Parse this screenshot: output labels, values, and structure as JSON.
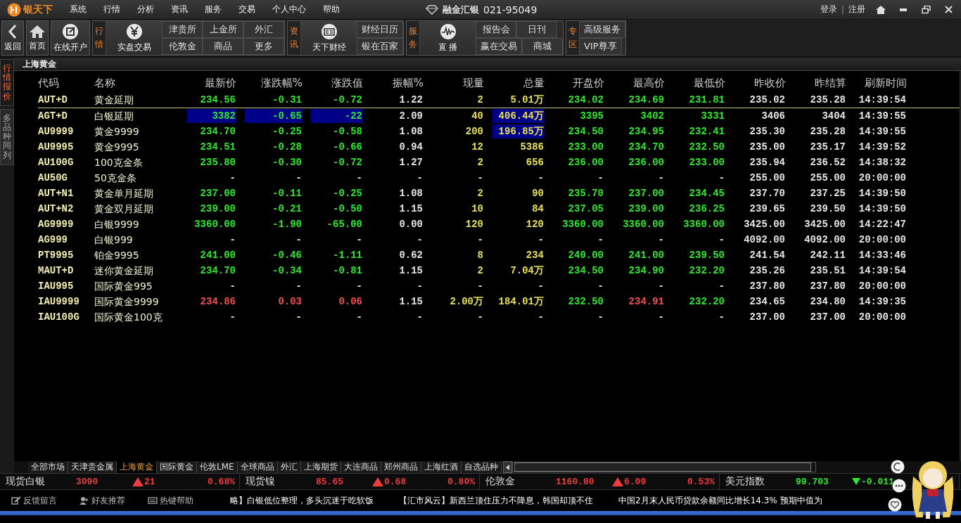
{
  "menu_bar": {
    "logo": "银天下",
    "items": [
      "系统",
      "行情",
      "分析",
      "资讯",
      "服务",
      "交易",
      "个人中心",
      "帮助"
    ],
    "brand": "融金汇银",
    "hotline": "021-95049",
    "login": "登录",
    "separator": "|",
    "register": "注册"
  },
  "toolbar": {
    "nav": [
      {
        "label": "返回"
      },
      {
        "label": "首页"
      },
      {
        "label": "在线开户"
      }
    ],
    "groups": [
      {
        "label": "行情",
        "feature": "实盘交易",
        "link_rows": [
          [
            "津贵所",
            "上金所",
            "外汇"
          ],
          [
            "伦敦金",
            "商品",
            "更多"
          ]
        ]
      },
      {
        "label": "资讯",
        "feature": "天下财经",
        "link_rows": [
          [
            "财经日历"
          ],
          [
            "银在百家"
          ]
        ]
      },
      {
        "label": "服务",
        "feature": "直 播",
        "link_rows": [
          [
            "报告会",
            "日刊"
          ],
          [
            "赢在交易",
            "商城"
          ]
        ]
      },
      {
        "label": "专区",
        "link_rows": [
          [
            "高级服务"
          ],
          [
            "VIP尊享"
          ]
        ]
      }
    ]
  },
  "side_tabs": [
    {
      "label": "行情报价",
      "selected": true
    },
    {
      "label": "多品种同列",
      "selected": false
    }
  ],
  "panel_title": "上海黄金",
  "table": {
    "columns": [
      "代码",
      "名称",
      "最新价",
      "涨跌幅%",
      "涨跌值",
      "振幅%",
      "现量",
      "总量",
      "开盘价",
      "最高价",
      "最低价",
      "昨收价",
      "昨结算",
      "刷新时间"
    ],
    "rows": [
      {
        "cells": [
          {
            "text": "AUT+D",
            "color": "#f2eeb0",
            "highlighted": false
          },
          {
            "text": "黄金延期",
            "color": "#f0f0d0",
            "highlighted": false
          },
          {
            "text": "234.56",
            "color": "#2ee82e",
            "highlighted": false
          },
          {
            "text": "-0.31",
            "color": "#2ee82e",
            "highlighted": false
          },
          {
            "text": "-0.72",
            "color": "#2ee82e",
            "highlighted": false
          },
          {
            "text": "1.22",
            "color": "#e6e6e6",
            "highlighted": false
          },
          {
            "text": "2",
            "color": "#e6e05a",
            "highlighted": false
          },
          {
            "text": "5.01万",
            "color": "#e6e05a",
            "highlighted": false
          },
          {
            "text": "234.02",
            "color": "#2ee82e",
            "highlighted": false
          },
          {
            "text": "234.69",
            "color": "#2ee82e",
            "highlighted": false
          },
          {
            "text": "231.81",
            "color": "#2ee82e",
            "highlighted": false
          },
          {
            "text": "235.02",
            "color": "#e6e6e6",
            "highlighted": false
          },
          {
            "text": "235.28",
            "color": "#e6e6e6",
            "highlighted": false
          },
          {
            "text": "14:39:54",
            "color": "#e6e6e6",
            "highlighted": false
          }
        ]
      },
      {
        "cells": [
          {
            "text": "AGT+D",
            "color": "#f2eeb0",
            "highlighted": false
          },
          {
            "text": "白银延期",
            "color": "#f0f0d0",
            "highlighted": false
          },
          {
            "text": "3382",
            "color": "#2ee82e",
            "highlighted": true
          },
          {
            "text": "-0.65",
            "color": "#2ee82e",
            "highlighted": true
          },
          {
            "text": "-22",
            "color": "#2ee82e",
            "highlighted": true
          },
          {
            "text": "2.09",
            "color": "#e6e6e6",
            "highlighted": false
          },
          {
            "text": "40",
            "color": "#e6e05a",
            "highlighted": false
          },
          {
            "text": "406.44万",
            "color": "#e6e05a",
            "highlighted": true
          },
          {
            "text": "3395",
            "color": "#2ee82e",
            "highlighted": false
          },
          {
            "text": "3402",
            "color": "#2ee82e",
            "highlighted": false
          },
          {
            "text": "3331",
            "color": "#2ee82e",
            "highlighted": false
          },
          {
            "text": "3406",
            "color": "#e6e6e6",
            "highlighted": false
          },
          {
            "text": "3404",
            "color": "#e6e6e6",
            "highlighted": false
          },
          {
            "text": "14:39:55",
            "color": "#e6e6e6",
            "highlighted": false
          }
        ]
      },
      {
        "cells": [
          {
            "text": "AU9999",
            "color": "#f2eeb0",
            "highlighted": false
          },
          {
            "text": "黄金9999",
            "color": "#f0f0d0",
            "highlighted": false
          },
          {
            "text": "234.70",
            "color": "#2ee82e",
            "highlighted": false
          },
          {
            "text": "-0.25",
            "color": "#2ee82e",
            "highlighted": false
          },
          {
            "text": "-0.58",
            "color": "#2ee82e",
            "highlighted": false
          },
          {
            "text": "1.08",
            "color": "#e6e6e6",
            "highlighted": false
          },
          {
            "text": "200",
            "color": "#e6e05a",
            "highlighted": false
          },
          {
            "text": "196.85万",
            "color": "#e6e05a",
            "highlighted": true
          },
          {
            "text": "234.50",
            "color": "#2ee82e",
            "highlighted": false
          },
          {
            "text": "234.95",
            "color": "#2ee82e",
            "highlighted": false
          },
          {
            "text": "232.41",
            "color": "#2ee82e",
            "highlighted": false
          },
          {
            "text": "235.30",
            "color": "#e6e6e6",
            "highlighted": false
          },
          {
            "text": "235.28",
            "color": "#e6e6e6",
            "highlighted": false
          },
          {
            "text": "14:39:55",
            "color": "#e6e6e6",
            "highlighted": false
          }
        ]
      },
      {
        "cells": [
          {
            "text": "AU9995",
            "color": "#f2eeb0",
            "highlighted": false
          },
          {
            "text": "黄金9995",
            "color": "#f0f0d0",
            "highlighted": false
          },
          {
            "text": "234.51",
            "color": "#2ee82e",
            "highlighted": false
          },
          {
            "text": "-0.28",
            "color": "#2ee82e",
            "highlighted": false
          },
          {
            "text": "-0.66",
            "color": "#2ee82e",
            "highlighted": false
          },
          {
            "text": "0.94",
            "color": "#e6e6e6",
            "highlighted": false
          },
          {
            "text": "12",
            "color": "#e6e05a",
            "highlighted": false
          },
          {
            "text": "5386",
            "color": "#e6e05a",
            "highlighted": false
          },
          {
            "text": "233.00",
            "color": "#2ee82e",
            "highlighted": false
          },
          {
            "text": "234.70",
            "color": "#2ee82e",
            "highlighted": false
          },
          {
            "text": "232.50",
            "color": "#2ee82e",
            "highlighted": false
          },
          {
            "text": "235.00",
            "color": "#e6e6e6",
            "highlighted": false
          },
          {
            "text": "235.17",
            "color": "#e6e6e6",
            "highlighted": false
          },
          {
            "text": "14:39:52",
            "color": "#e6e6e6",
            "highlighted": false
          }
        ]
      },
      {
        "cells": [
          {
            "text": "AU100G",
            "color": "#f2eeb0",
            "highlighted": false
          },
          {
            "text": "100克金条",
            "color": "#f0f0d0",
            "highlighted": false
          },
          {
            "text": "235.80",
            "color": "#2ee82e",
            "highlighted": false
          },
          {
            "text": "-0.30",
            "color": "#2ee82e",
            "highlighted": false
          },
          {
            "text": "-0.72",
            "color": "#2ee82e",
            "highlighted": false
          },
          {
            "text": "1.27",
            "color": "#e6e6e6",
            "highlighted": false
          },
          {
            "text": "2",
            "color": "#e6e05a",
            "highlighted": false
          },
          {
            "text": "656",
            "color": "#e6e05a",
            "highlighted": false
          },
          {
            "text": "236.00",
            "color": "#2ee82e",
            "highlighted": false
          },
          {
            "text": "236.00",
            "color": "#2ee82e",
            "highlighted": false
          },
          {
            "text": "233.00",
            "color": "#2ee82e",
            "highlighted": false
          },
          {
            "text": "235.94",
            "color": "#e6e6e6",
            "highlighted": false
          },
          {
            "text": "236.52",
            "color": "#e6e6e6",
            "highlighted": false
          },
          {
            "text": "14:38:32",
            "color": "#e6e6e6",
            "highlighted": false
          }
        ]
      },
      {
        "cells": [
          {
            "text": "AU50G",
            "color": "#f2eeb0",
            "highlighted": false
          },
          {
            "text": "50克金条",
            "color": "#f0f0d0",
            "highlighted": false
          },
          {
            "text": "-",
            "color": "#e6e6e6",
            "highlighted": false
          },
          {
            "text": "-",
            "color": "#e6e6e6",
            "highlighted": false
          },
          {
            "text": "-",
            "color": "#e6e6e6",
            "highlighted": false
          },
          {
            "text": "-",
            "color": "#e6e6e6",
            "highlighted": false
          },
          {
            "text": "-",
            "color": "#e6e6e6",
            "highlighted": false
          },
          {
            "text": "-",
            "color": "#e6e6e6",
            "highlighted": false
          },
          {
            "text": "-",
            "color": "#e6e6e6",
            "highlighted": false
          },
          {
            "text": "-",
            "color": "#e6e6e6",
            "highlighted": false
          },
          {
            "text": "-",
            "color": "#e6e6e6",
            "highlighted": false
          },
          {
            "text": "255.00",
            "color": "#e6e6e6",
            "highlighted": false
          },
          {
            "text": "255.00",
            "color": "#e6e6e6",
            "highlighted": false
          },
          {
            "text": "20:00:00",
            "color": "#e6e6e6",
            "highlighted": false
          }
        ]
      },
      {
        "cells": [
          {
            "text": "AUT+N1",
            "color": "#f2eeb0",
            "highlighted": false
          },
          {
            "text": "黄金单月延期",
            "color": "#f0f0d0",
            "highlighted": false
          },
          {
            "text": "237.00",
            "color": "#2ee82e",
            "highlighted": false
          },
          {
            "text": "-0.11",
            "color": "#2ee82e",
            "highlighted": false
          },
          {
            "text": "-0.25",
            "color": "#2ee82e",
            "highlighted": false
          },
          {
            "text": "1.08",
            "color": "#e6e6e6",
            "highlighted": false
          },
          {
            "text": "2",
            "color": "#e6e05a",
            "highlighted": false
          },
          {
            "text": "90",
            "color": "#e6e05a",
            "highlighted": false
          },
          {
            "text": "235.70",
            "color": "#2ee82e",
            "highlighted": false
          },
          {
            "text": "237.00",
            "color": "#2ee82e",
            "highlighted": false
          },
          {
            "text": "234.45",
            "color": "#2ee82e",
            "highlighted": false
          },
          {
            "text": "237.70",
            "color": "#e6e6e6",
            "highlighted": false
          },
          {
            "text": "237.25",
            "color": "#e6e6e6",
            "highlighted": false
          },
          {
            "text": "14:39:50",
            "color": "#e6e6e6",
            "highlighted": false
          }
        ]
      },
      {
        "cells": [
          {
            "text": "AUT+N2",
            "color": "#f2eeb0",
            "highlighted": false
          },
          {
            "text": "黄金双月延期",
            "color": "#f0f0d0",
            "highlighted": false
          },
          {
            "text": "239.00",
            "color": "#2ee82e",
            "highlighted": false
          },
          {
            "text": "-0.21",
            "color": "#2ee82e",
            "highlighted": false
          },
          {
            "text": "-0.50",
            "color": "#2ee82e",
            "highlighted": false
          },
          {
            "text": "1.15",
            "color": "#e6e6e6",
            "highlighted": false
          },
          {
            "text": "10",
            "color": "#e6e05a",
            "highlighted": false
          },
          {
            "text": "84",
            "color": "#e6e05a",
            "highlighted": false
          },
          {
            "text": "237.05",
            "color": "#2ee82e",
            "highlighted": false
          },
          {
            "text": "239.00",
            "color": "#2ee82e",
            "highlighted": false
          },
          {
            "text": "236.25",
            "color": "#2ee82e",
            "highlighted": false
          },
          {
            "text": "239.65",
            "color": "#e6e6e6",
            "highlighted": false
          },
          {
            "text": "239.50",
            "color": "#e6e6e6",
            "highlighted": false
          },
          {
            "text": "14:39:50",
            "color": "#e6e6e6",
            "highlighted": false
          }
        ]
      },
      {
        "cells": [
          {
            "text": "AG9999",
            "color": "#f2eeb0",
            "highlighted": false
          },
          {
            "text": "白银9999",
            "color": "#f0f0d0",
            "highlighted": false
          },
          {
            "text": "3360.00",
            "color": "#2ee82e",
            "highlighted": false
          },
          {
            "text": "-1.90",
            "color": "#2ee82e",
            "highlighted": false
          },
          {
            "text": "-65.00",
            "color": "#2ee82e",
            "highlighted": false
          },
          {
            "text": "0.00",
            "color": "#e6e6e6",
            "highlighted": false
          },
          {
            "text": "120",
            "color": "#e6e05a",
            "highlighted": false
          },
          {
            "text": "120",
            "color": "#e6e05a",
            "highlighted": false
          },
          {
            "text": "3360.00",
            "color": "#2ee82e",
            "highlighted": false
          },
          {
            "text": "3360.00",
            "color": "#2ee82e",
            "highlighted": false
          },
          {
            "text": "3360.00",
            "color": "#2ee82e",
            "highlighted": false
          },
          {
            "text": "3425.00",
            "color": "#e6e6e6",
            "highlighted": false
          },
          {
            "text": "3425.00",
            "color": "#e6e6e6",
            "highlighted": false
          },
          {
            "text": "14:22:47",
            "color": "#e6e6e6",
            "highlighted": false
          }
        ]
      },
      {
        "cells": [
          {
            "text": "AG999",
            "color": "#f2eeb0",
            "highlighted": false
          },
          {
            "text": "白银999",
            "color": "#f0f0d0",
            "highlighted": false
          },
          {
            "text": "-",
            "color": "#e6e6e6",
            "highlighted": false
          },
          {
            "text": "-",
            "color": "#e6e6e6",
            "highlighted": false
          },
          {
            "text": "-",
            "color": "#e6e6e6",
            "highlighted": false
          },
          {
            "text": "-",
            "color": "#e6e6e6",
            "highlighted": false
          },
          {
            "text": "-",
            "color": "#e6e6e6",
            "highlighted": false
          },
          {
            "text": "-",
            "color": "#e6e6e6",
            "highlighted": false
          },
          {
            "text": "-",
            "color": "#e6e6e6",
            "highlighted": false
          },
          {
            "text": "-",
            "color": "#e6e6e6",
            "highlighted": false
          },
          {
            "text": "-",
            "color": "#e6e6e6",
            "highlighted": false
          },
          {
            "text": "4092.00",
            "color": "#e6e6e6",
            "highlighted": false
          },
          {
            "text": "4092.00",
            "color": "#e6e6e6",
            "highlighted": false
          },
          {
            "text": "20:00:00",
            "color": "#e6e6e6",
            "highlighted": false
          }
        ]
      },
      {
        "cells": [
          {
            "text": "PT9995",
            "color": "#f2eeb0",
            "highlighted": false
          },
          {
            "text": "铂金9995",
            "color": "#f0f0d0",
            "highlighted": false
          },
          {
            "text": "241.00",
            "color": "#2ee82e",
            "highlighted": false
          },
          {
            "text": "-0.46",
            "color": "#2ee82e",
            "highlighted": false
          },
          {
            "text": "-1.11",
            "color": "#2ee82e",
            "highlighted": false
          },
          {
            "text": "0.62",
            "color": "#e6e6e6",
            "highlighted": false
          },
          {
            "text": "8",
            "color": "#e6e05a",
            "highlighted": false
          },
          {
            "text": "234",
            "color": "#e6e05a",
            "highlighted": false
          },
          {
            "text": "240.00",
            "color": "#2ee82e",
            "highlighted": false
          },
          {
            "text": "241.00",
            "color": "#2ee82e",
            "highlighted": false
          },
          {
            "text": "239.50",
            "color": "#2ee82e",
            "highlighted": false
          },
          {
            "text": "241.54",
            "color": "#e6e6e6",
            "highlighted": false
          },
          {
            "text": "242.11",
            "color": "#e6e6e6",
            "highlighted": false
          },
          {
            "text": "14:33:46",
            "color": "#e6e6e6",
            "highlighted": false
          }
        ]
      },
      {
        "cells": [
          {
            "text": "MAUT+D",
            "color": "#f2eeb0",
            "highlighted": false
          },
          {
            "text": "迷你黄金延期",
            "color": "#f0f0d0",
            "highlighted": false
          },
          {
            "text": "234.70",
            "color": "#2ee82e",
            "highlighted": false
          },
          {
            "text": "-0.34",
            "color": "#2ee82e",
            "highlighted": false
          },
          {
            "text": "-0.81",
            "color": "#2ee82e",
            "highlighted": false
          },
          {
            "text": "1.15",
            "color": "#e6e6e6",
            "highlighted": false
          },
          {
            "text": "2",
            "color": "#e6e05a",
            "highlighted": false
          },
          {
            "text": "7.04万",
            "color": "#e6e05a",
            "highlighted": false
          },
          {
            "text": "234.50",
            "color": "#2ee82e",
            "highlighted": false
          },
          {
            "text": "234.90",
            "color": "#2ee82e",
            "highlighted": false
          },
          {
            "text": "232.20",
            "color": "#2ee82e",
            "highlighted": false
          },
          {
            "text": "235.26",
            "color": "#e6e6e6",
            "highlighted": false
          },
          {
            "text": "235.51",
            "color": "#e6e6e6",
            "highlighted": false
          },
          {
            "text": "14:39:54",
            "color": "#e6e6e6",
            "highlighted": false
          }
        ]
      },
      {
        "cells": [
          {
            "text": "IAU995",
            "color": "#f2eeb0",
            "highlighted": false
          },
          {
            "text": "国际黄金995",
            "color": "#f0f0d0",
            "highlighted": false
          },
          {
            "text": "-",
            "color": "#e6e6e6",
            "highlighted": false
          },
          {
            "text": "-",
            "color": "#e6e6e6",
            "highlighted": false
          },
          {
            "text": "-",
            "color": "#e6e6e6",
            "highlighted": false
          },
          {
            "text": "-",
            "color": "#e6e6e6",
            "highlighted": false
          },
          {
            "text": "-",
            "color": "#e6e6e6",
            "highlighted": false
          },
          {
            "text": "-",
            "color": "#e6e6e6",
            "highlighted": false
          },
          {
            "text": "-",
            "color": "#e6e6e6",
            "highlighted": false
          },
          {
            "text": "-",
            "color": "#e6e6e6",
            "highlighted": false
          },
          {
            "text": "-",
            "color": "#e6e6e6",
            "highlighted": false
          },
          {
            "text": "237.80",
            "color": "#e6e6e6",
            "highlighted": false
          },
          {
            "text": "237.80",
            "color": "#e6e6e6",
            "highlighted": false
          },
          {
            "text": "20:00:00",
            "color": "#e6e6e6",
            "highlighted": false
          }
        ]
      },
      {
        "cells": [
          {
            "text": "IAU9999",
            "color": "#f2eeb0",
            "highlighted": false
          },
          {
            "text": "国际黄金9999",
            "color": "#f0f0d0",
            "highlighted": false
          },
          {
            "text": "234.86",
            "color": "#f05050",
            "highlighted": false
          },
          {
            "text": "0.03",
            "color": "#f05050",
            "highlighted": false
          },
          {
            "text": "0.06",
            "color": "#f05050",
            "highlighted": false
          },
          {
            "text": "1.15",
            "color": "#e6e6e6",
            "highlighted": false
          },
          {
            "text": "2.00万",
            "color": "#e6e05a",
            "highlighted": false
          },
          {
            "text": "184.01万",
            "color": "#e6e05a",
            "highlighted": false
          },
          {
            "text": "232.50",
            "color": "#2ee82e",
            "highlighted": false
          },
          {
            "text": "234.91",
            "color": "#f05050",
            "highlighted": false
          },
          {
            "text": "232.20",
            "color": "#2ee82e",
            "highlighted": false
          },
          {
            "text": "234.65",
            "color": "#e6e6e6",
            "highlighted": false
          },
          {
            "text": "234.80",
            "color": "#e6e6e6",
            "highlighted": false
          },
          {
            "text": "14:39:35",
            "color": "#e6e6e6",
            "highlighted": false
          }
        ]
      },
      {
        "cells": [
          {
            "text": "IAU100G",
            "color": "#f2eeb0",
            "highlighted": false
          },
          {
            "text": "国际黄金100克",
            "color": "#f0f0d0",
            "highlighted": false
          },
          {
            "text": "-",
            "color": "#e6e6e6",
            "highlighted": false
          },
          {
            "text": "-",
            "color": "#e6e6e6",
            "highlighted": false
          },
          {
            "text": "-",
            "color": "#e6e6e6",
            "highlighted": false
          },
          {
            "text": "-",
            "color": "#e6e6e6",
            "highlighted": false
          },
          {
            "text": "-",
            "color": "#e6e6e6",
            "highlighted": false
          },
          {
            "text": "-",
            "color": "#e6e6e6",
            "highlighted": false
          },
          {
            "text": "-",
            "color": "#e6e6e6",
            "highlighted": false
          },
          {
            "text": "-",
            "color": "#e6e6e6",
            "highlighted": false
          },
          {
            "text": "-",
            "color": "#e6e6e6",
            "highlighted": false
          },
          {
            "text": "237.00",
            "color": "#e6e6e6",
            "highlighted": false
          },
          {
            "text": "237.00",
            "color": "#e6e6e6",
            "highlighted": false
          },
          {
            "text": "20:00:00",
            "color": "#e6e6e6",
            "highlighted": false
          }
        ]
      }
    ]
  },
  "market_tabs": [
    {
      "label": "全部市场",
      "selected": false
    },
    {
      "label": "天津贵金属",
      "selected": false
    },
    {
      "label": "上海黄金",
      "selected": true
    },
    {
      "label": "国际黄金",
      "selected": false
    },
    {
      "label": "伦敦LME",
      "selected": false
    },
    {
      "label": "全球商品",
      "selected": false
    },
    {
      "label": "外汇",
      "selected": false
    },
    {
      "label": "上海期货",
      "selected": false
    },
    {
      "label": "大连商品",
      "selected": false
    },
    {
      "label": "郑州商品",
      "selected": false
    },
    {
      "label": "上海红酒",
      "selected": false
    },
    {
      "label": "自选品种",
      "selected": false
    }
  ],
  "ticker": [
    {
      "name": "现货白银",
      "price": "3090",
      "kind": "up",
      "change": "21",
      "percent": "0.68%"
    },
    {
      "name": "现货镍",
      "price": "85.65",
      "kind": "up",
      "change": "0.68",
      "percent": "0.80%"
    },
    {
      "name": "伦敦金",
      "price": "1160.80",
      "kind": "up",
      "change": "6.09",
      "percent": "0.53%"
    },
    {
      "name": "美元指数",
      "price": "99.703",
      "kind": "down",
      "change": "-0.011"
    }
  ],
  "status_bar": {
    "links": [
      "反馈留言",
      "好友推荐",
      "热键帮助"
    ],
    "news": [
      "略】白银低位整理，多头沉迷于吃软饭",
      "【汇市风云】新西兰顶住压力不降息，韩国却顶不住",
      "中国2月末人民币贷款余额同比增长14.3% 预期中值为"
    ]
  }
}
